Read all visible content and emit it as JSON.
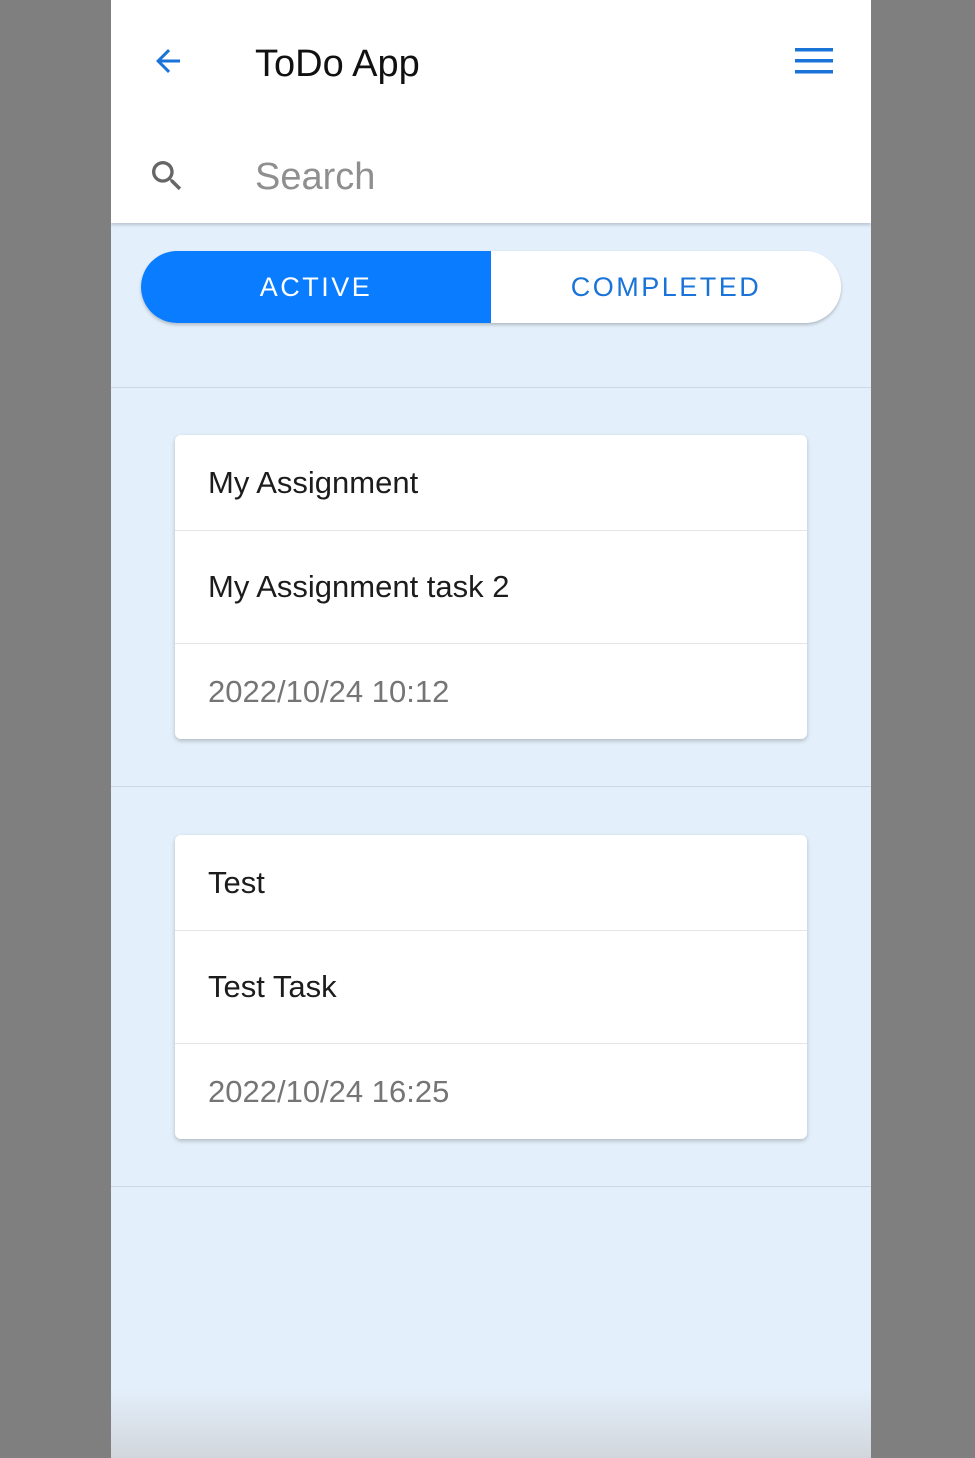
{
  "header": {
    "title": "ToDo App",
    "back_icon": "arrow-left-icon",
    "menu_icon": "hamburger-menu-icon"
  },
  "search": {
    "placeholder": "Search",
    "value": "",
    "icon": "search-icon"
  },
  "tabs": [
    {
      "label": "ACTIVE",
      "selected": true
    },
    {
      "label": "COMPLETED",
      "selected": false
    }
  ],
  "tasks": [
    {
      "title": "My Assignment",
      "description": "My Assignment task 2",
      "timestamp": "2022/10/24 10:12"
    },
    {
      "title": "Test",
      "description": "Test Task",
      "timestamp": "2022/10/24 16:25"
    }
  ],
  "colors": {
    "accent": "#0a7cff",
    "accent_text": "#1a73d9",
    "background": "#e3effb",
    "outer_frame": "#7f7f7f"
  }
}
